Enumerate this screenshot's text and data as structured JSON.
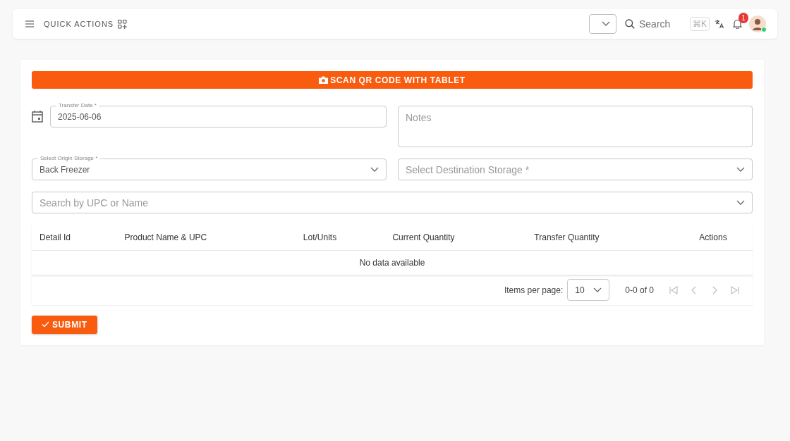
{
  "header": {
    "title": "QUICK ACTIONS",
    "search": {
      "placeholder": "Search"
    },
    "shortcut": "⌘K",
    "notifications": {
      "count": "1"
    },
    "avatar": {
      "online": true
    }
  },
  "form": {
    "scan_button": "SCAN QR CODE WITH TABLET",
    "transfer_date": {
      "label": "Transfer Date *",
      "value": "2025-06-06"
    },
    "notes": {
      "placeholder": "Notes"
    },
    "origin_storage": {
      "label": "Select Origin Storage *",
      "value": "Back Freezer"
    },
    "destination_storage": {
      "placeholder": "Select Destination Storage *"
    },
    "product_search": {
      "placeholder": "Search by UPC or Name"
    },
    "table": {
      "columns": [
        "Detail Id",
        "Product Name & UPC",
        "Lot/Units",
        "Current Quantity",
        "Transfer Quantity",
        "Actions"
      ],
      "empty_message": "No data available"
    },
    "pagination": {
      "items_per_page_label": "Items per page:",
      "items_per_page": "10",
      "range": "0-0 of 0",
      "buttons": [
        {
          "kind": "first",
          "disabled": true
        },
        {
          "kind": "prev",
          "disabled": true
        },
        {
          "kind": "next",
          "disabled": true
        },
        {
          "kind": "last",
          "disabled": true
        }
      ]
    },
    "submit_button": "SUBMIT"
  }
}
